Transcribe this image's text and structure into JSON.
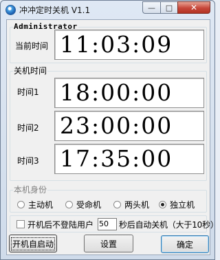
{
  "window": {
    "title": "冲冲定时关机 V1.1",
    "app_icon": "app-icon",
    "caption": {
      "minimize": "—",
      "maximize": "□",
      "close": "✕"
    }
  },
  "admin_group": {
    "label": "Administrator",
    "current_time_label": "当前时间",
    "current_time": "11:03:09"
  },
  "shutdown_group": {
    "label": "关机时间",
    "rows": [
      {
        "label": "时间1",
        "value": "18:00:00"
      },
      {
        "label": "时间2",
        "value": "23:00:00"
      },
      {
        "label": "时间3",
        "value": "17:35:00"
      }
    ]
  },
  "identity_group": {
    "label": "本机身份",
    "options": [
      {
        "label": "主动机",
        "checked": false
      },
      {
        "label": "受命机",
        "checked": false
      },
      {
        "label": "两头机",
        "checked": false
      },
      {
        "label": "独立机",
        "checked": true
      }
    ]
  },
  "option_group": {
    "prefix": "开机后不登陆用户",
    "seconds_value": "50",
    "suffix": "秒后自动关机（大于10秒）",
    "checked": false
  },
  "buttons": {
    "autostart": "开机自启动",
    "settings": "设置",
    "ok": "确定"
  }
}
